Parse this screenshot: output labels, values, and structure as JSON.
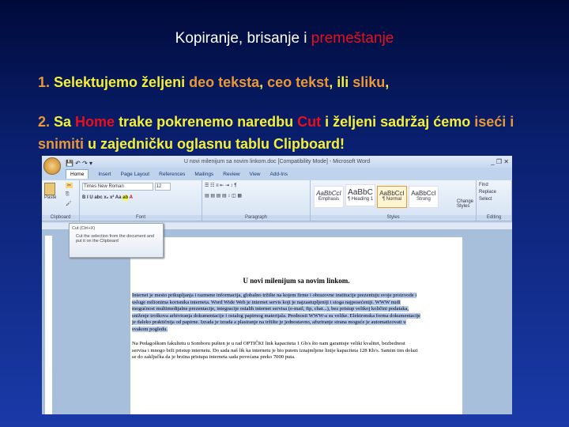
{
  "slide": {
    "title_a": "Kopiranje, brisanje i ",
    "title_b": "premeštanje",
    "l1": [
      "1. ",
      "Selektujemo željeni ",
      "deo teksta",
      ", ",
      "ceo tekst",
      ", ili ",
      "sliku",
      ","
    ],
    "l2": [
      "2. ",
      "Sa ",
      "Home",
      " trake pokrenemo naredbu ",
      "Cut",
      " i željeni sadržaj ćemo ",
      "iseći i snimiti",
      " u zajedničku oglasnu tablu Clipboard!"
    ]
  },
  "word": {
    "title": "U novi milenijum sa novim linkom.doc [Compatibility Mode] - Microsoft Word",
    "window_controls": "_ ❐ ✕",
    "tabs": [
      "Home",
      "Insert",
      "Page Layout",
      "References",
      "Mailings",
      "Review",
      "View",
      "Add-Ins"
    ],
    "groups": {
      "clipboard": "Clipboard",
      "font": "Font",
      "paragraph": "Paragraph",
      "styles": "Styles",
      "editing": "Editing"
    },
    "paste": "Paste",
    "font_name": "Times New Roman",
    "font_size": "12",
    "styles": [
      {
        "sample": "AaBbCcI",
        "name": "Emphasis"
      },
      {
        "sample": "AaBbC",
        "name": "¶ Heading 1"
      },
      {
        "sample": "AaBbCcI",
        "name": "¶ Normal"
      },
      {
        "sample": "AaBbCcI",
        "name": "Strong"
      }
    ],
    "change_styles": "Change Styles",
    "editing": [
      "Find",
      "Replace",
      "Select"
    ],
    "tooltip": {
      "title": "Cut (Ctrl+X)",
      "body": "Cut the selection from the document and put it on the Clipboard"
    },
    "doc": {
      "heading": "U novi milenijum sa novim linkom.",
      "p1": "Internet je mesto prikupljanja i razmene informacija, globalno tržište na kojem firme i obrazovne institucije prezentuju svoje proizvode i usluge milionima korisnika interneta. Word Wide Web je internet servis koji je najzastupljeniji i stoga najposećeniji. WWW nudi mogućnost multimedijalne prezentacije, integracije ostalih internet servisa (e-mail, ftp, chat...), bez pristup velikoj količini podataka, sniženje troškova arhiviranja dokumentacije i ostalog papirnog materijala. Prednosti WWW-a su velike. Elektronska forma dokumentacije je daleko praktičnija od papirne. Izrada je izrada a plasiranje na tržište je jednostavno, ažuriranje strana moguće je automatizovati u svakom pogledu.",
      "p2": "Na Pedagoškom fakultetu u Somboru pušten je u rad OPTIČKI link kapaciteta 1 Gb/s što nam garantuje veliki kvalitet, bezbednost servisa i mnogo brži pristup internetu. Do sada naš lik ka internetu je bio putem iznajmljene linije kapaciteta 128 Kb/s. Samim tim dolazi se do zaključka da je brzina pristupa interneta sada povećana preko 7000 puta."
    }
  }
}
